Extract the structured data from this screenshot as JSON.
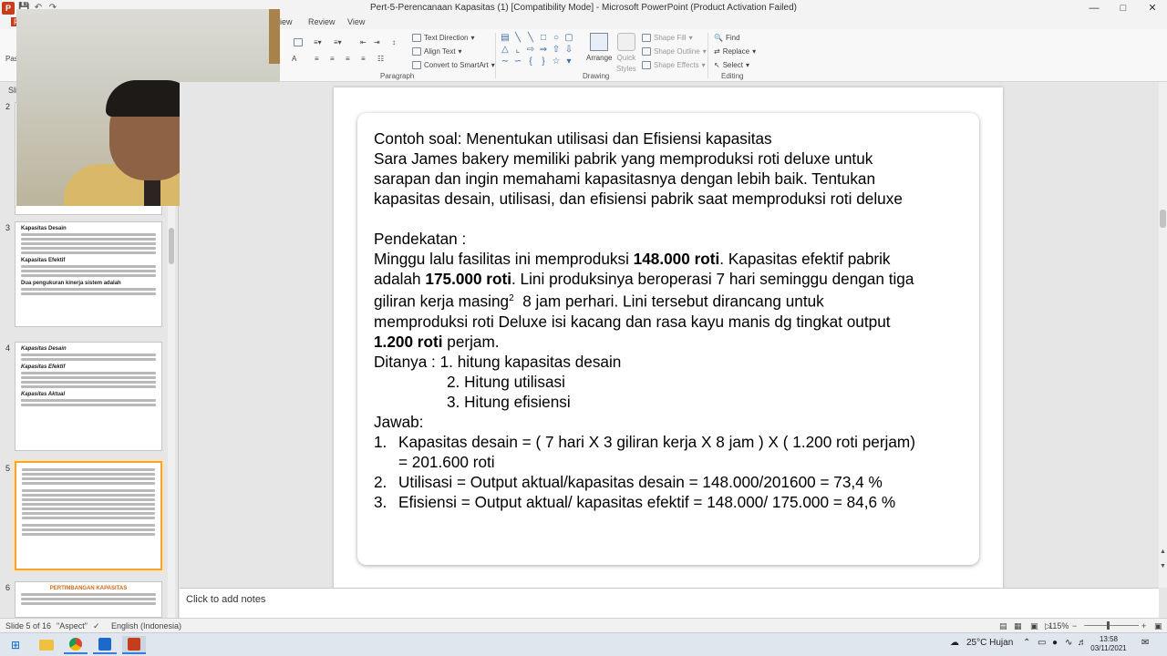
{
  "window": {
    "title": "Pert-5-Perencanaan Kapasitas (1) [Compatibility Mode] - Microsoft PowerPoint (Product Activation Failed)",
    "app_letter": "P",
    "minimize": "—",
    "maximize": "□",
    "close": "✕"
  },
  "ribbon": {
    "tabs": [
      "F",
      "iew",
      "Review",
      "View"
    ],
    "pas_label": "Pas",
    "groups": {
      "paragraph": "Paragraph",
      "drawing": "Drawing",
      "editing": "Editing"
    },
    "text_direction": "Text Direction",
    "align_text": "Align Text",
    "convert_smartart": "Convert to SmartArt",
    "arrange": "Arrange",
    "quick_styles_1": "Quick",
    "quick_styles_2": "Styles",
    "shape_fill": "Shape Fill",
    "shape_outline": "Shape Outline",
    "shape_effects": "Shape Effects",
    "find": "Find",
    "replace": "Replace",
    "select": "Select"
  },
  "slides_panel": {
    "header": "Sli",
    "thumb3_t1": "Kapasitas Desain",
    "thumb3_t2": "Kapasitas Efektif",
    "thumb3_t3": "Dua pengukuran kinerja sistem adalah",
    "thumb4_t1": "Kapasitas Desain",
    "thumb4_t2": "Kapasitas Efektif",
    "thumb4_t3": "Kapasitas Aktual",
    "thumb6_title": "PERTIMBANGAN KAPASITAS",
    "numbers": [
      "2",
      "3",
      "4",
      "5",
      "6"
    ]
  },
  "slide": {
    "title_prefix": "Contoh soal: ",
    "title_rest": "Menentukan utilisasi dan Efisiensi kapasitas",
    "p1_l1": "Sara James bakery memiliki pabrik yang memproduksi roti deluxe untuk",
    "p1_l2": "sarapan dan ingin memahami kapasitasnya dengan lebih baik. Tentukan",
    "p1_l3": "kapasitas desain, utilisasi, dan efisiensi pabrik saat memproduksi roti deluxe",
    "pendekatan": "Pendekatan :",
    "l1_a": "Minggu lalu fasilitas ini memproduksi ",
    "l1_b": "148.000 roti",
    "l1_c": ". Kapasitas efektif pabrik",
    "l2_a": "adalah ",
    "l2_b": "175.000 roti",
    "l2_c": ". Lini produksinya beroperasi 7 hari seminggu dengan tiga",
    "l3_a": "giliran kerja masing",
    "l3_sup": "2",
    "l3_b": "  8 jam perhari. Lini tersebut dirancang untuk",
    "l4": "memproduksi roti Deluxe isi kacang dan rasa kayu manis dg tingkat output",
    "l5_a": "1.200 roti",
    "l5_b": " perjam.",
    "ditanya": "Ditanya : 1.  hitung kapasitas desain",
    "ditanya2": "2.  Hitung utilisasi",
    "ditanya3": "3.  Hitung efisiensi",
    "jawab": "Jawab:",
    "a1_num": "1.",
    "a1": "Kapasitas desain = ( 7 hari X 3 giliran kerja X 8 jam ) X ( 1.200 roti perjam)",
    "a1b": "= 201.600 roti",
    "a2_num": "2.",
    "a2": "Utilisasi = Output aktual/kapasitas desain = 148.000/201600 = 73,4 %",
    "a3_num": "3.",
    "a3": "Efisiensi = Output aktual/ kapasitas efektif = 148.000/ 175.000 = 84,6 %"
  },
  "notes": {
    "placeholder": "Click to add notes"
  },
  "status": {
    "slide_of": "Slide 5 of 16",
    "theme": "\"Aspect\"",
    "language": "English (Indonesia)",
    "zoom": "115%",
    "zoom_minus": "−",
    "zoom_plus": "+"
  },
  "taskbar": {
    "weather": "25°C  Hujan",
    "time": "13:58",
    "date": "03/11/2021"
  }
}
